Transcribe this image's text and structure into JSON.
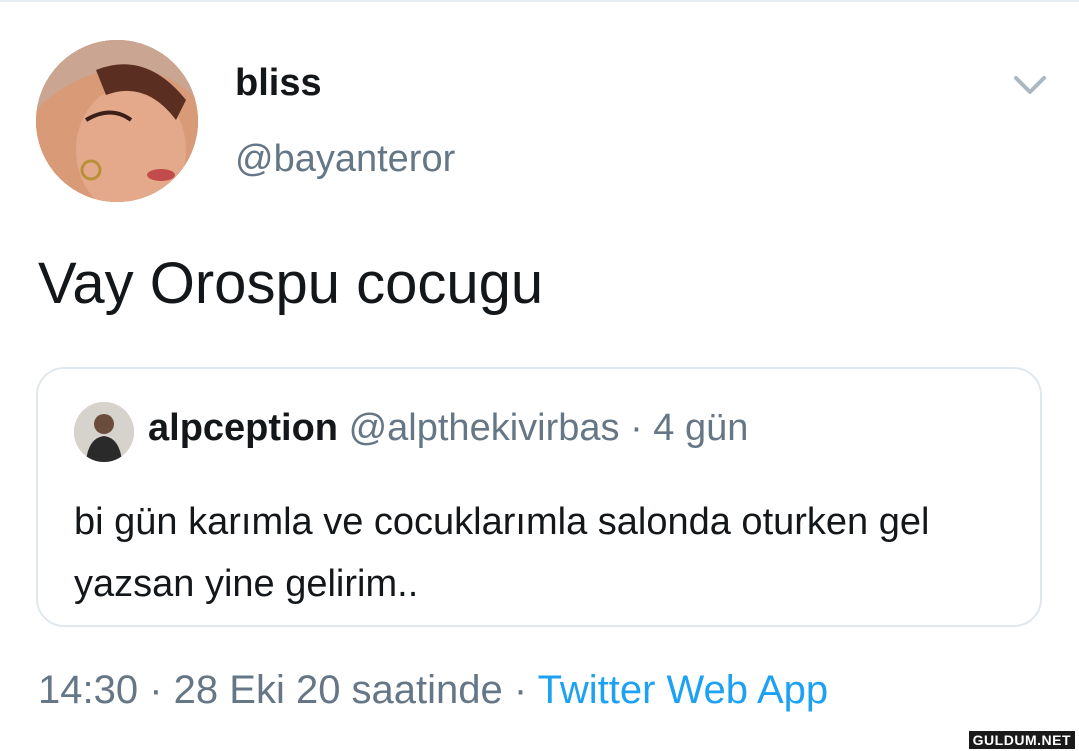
{
  "tweet": {
    "display_name": "bliss",
    "handle": "@bayanteror",
    "text": "Vay Orospu cocugu",
    "avatar_icon": "user-photo-avatar"
  },
  "quoted_tweet": {
    "display_name": "alpception",
    "handle": "@alpthekivirbas",
    "separator": " · ",
    "age": "4 gün",
    "text": "bi gün karımla ve cocuklarımla salonda oturken gel yazsan yine gelirim.."
  },
  "footer": {
    "time": "14:30",
    "separator": " · ",
    "date": "28 Eki 20 saatinde",
    "source_separator": " · ",
    "source": "Twitter Web App"
  },
  "watermark": {
    "text": "GULDUM.NET"
  },
  "colors": {
    "link": "#1da1f2",
    "secondary": "#657786",
    "border": "#e1e8ed"
  }
}
